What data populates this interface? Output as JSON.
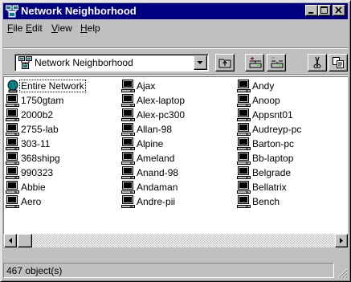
{
  "window": {
    "title": "Network Neighborhood",
    "title_icon": "network-neighborhood-icon"
  },
  "title_buttons": [
    {
      "name": "minimize-button",
      "icon": "minimize-icon"
    },
    {
      "name": "maximize-button",
      "icon": "maximize-icon"
    },
    {
      "name": "close-button",
      "icon": "close-icon"
    }
  ],
  "menu": {
    "file": {
      "accel": "F",
      "rest": "ile"
    },
    "edit": {
      "accel": "E",
      "rest": "dit"
    },
    "view": {
      "accel": "V",
      "rest": "iew"
    },
    "help": {
      "accel": "H",
      "rest": "elp"
    }
  },
  "address": {
    "value": "Network Neighborhood",
    "icon": "network-neighborhood-icon"
  },
  "toolbar_buttons": [
    {
      "name": "up-one-level-button",
      "icon": "up-folder-icon"
    },
    {
      "name": "map-network-drive-button",
      "icon": "map-drive-icon"
    },
    {
      "name": "disconnect-drive-button",
      "icon": "disconnect-drive-icon"
    },
    {
      "name": "cut-button",
      "icon": "scissors-icon"
    },
    {
      "name": "copy-button",
      "icon": "copy-icon"
    }
  ],
  "columns": [
    [
      "Entire Network",
      "1750gtam",
      "2000b2",
      "2755-lab",
      "303-11",
      "368shipg",
      "990323",
      "Abbie",
      "Aero"
    ],
    [
      "Ajax",
      "Alex-laptop",
      "Alex-pc300",
      "Allan-98",
      "Alpine",
      "Ameland",
      "Anand-98",
      "Andaman",
      "Andre-pii"
    ],
    [
      "Andy",
      "Anoop",
      "Appsnt01",
      "Audreyp-pc",
      "Barton-pc",
      "Bb-laptop",
      "Belgrade",
      "Bellatrix",
      "Bench"
    ]
  ],
  "status": {
    "text": "467 object(s)"
  },
  "colors": {
    "titlebar": "#000080",
    "face": "#c0c0c0",
    "window_bg": "#ffffff"
  }
}
